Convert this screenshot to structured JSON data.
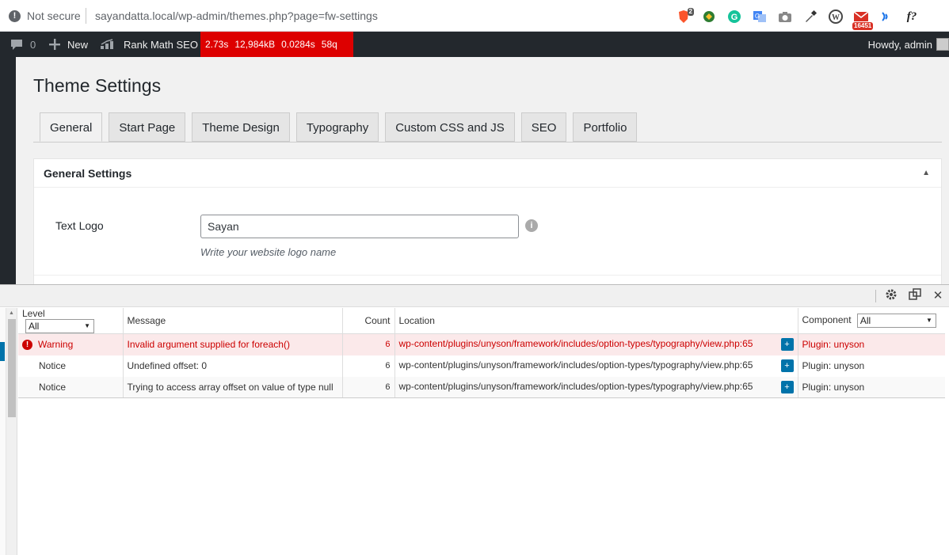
{
  "browser": {
    "security_label": "Not secure",
    "url": "sayandatta.local/wp-admin/themes.php?page=fw-settings",
    "extensions": [
      {
        "name": "brave-shield-icon",
        "badge": "2"
      },
      {
        "name": "idm-icon"
      },
      {
        "name": "grammarly-icon"
      },
      {
        "name": "google-translate-icon"
      },
      {
        "name": "camera-icon"
      },
      {
        "name": "eyedropper-icon"
      },
      {
        "name": "wordpress-icon"
      },
      {
        "name": "mail-icon",
        "badge": "16451"
      },
      {
        "name": "wifi-icon"
      },
      {
        "name": "font-icon",
        "label": "f?"
      }
    ]
  },
  "adminbar": {
    "comments_count": "0",
    "new_label": "New",
    "rankmath_label": "Rank Math SEO",
    "qm": {
      "time": "2.73s",
      "memory": "12,984kB",
      "db_time": "0.0284s",
      "queries": "58q"
    },
    "howdy": "Howdy, admin"
  },
  "page": {
    "title": "Theme Settings",
    "tabs": [
      "General",
      "Start Page",
      "Theme Design",
      "Typography",
      "Custom CSS and JS",
      "SEO",
      "Portfolio"
    ],
    "active_tab": "General",
    "box_title": "General Settings",
    "option": {
      "label": "Text Logo",
      "value": "Sayan",
      "description": "Write your website logo name"
    }
  },
  "qm_panel": {
    "columns": {
      "level": "Level",
      "message": "Message",
      "count": "Count",
      "location": "Location",
      "component": "Component"
    },
    "level_filter": "All",
    "component_filter": "All",
    "rows": [
      {
        "level": "Warning",
        "message": "Invalid argument supplied for foreach()",
        "count": "6",
        "location": "wp-content/plugins/unyson/framework/includes/option-types/typography/view.php:65",
        "component": "Plugin: unyson"
      },
      {
        "level": "Notice",
        "message": "Undefined offset: 0",
        "count": "6",
        "location": "wp-content/plugins/unyson/framework/includes/option-types/typography/view.php:65",
        "component": "Plugin: unyson"
      },
      {
        "level": "Notice",
        "message": "Trying to access array offset on value of type null",
        "count": "6",
        "location": "wp-content/plugins/unyson/framework/includes/option-types/typography/view.php:65",
        "component": "Plugin: unyson"
      }
    ],
    "expand_label": "+"
  }
}
